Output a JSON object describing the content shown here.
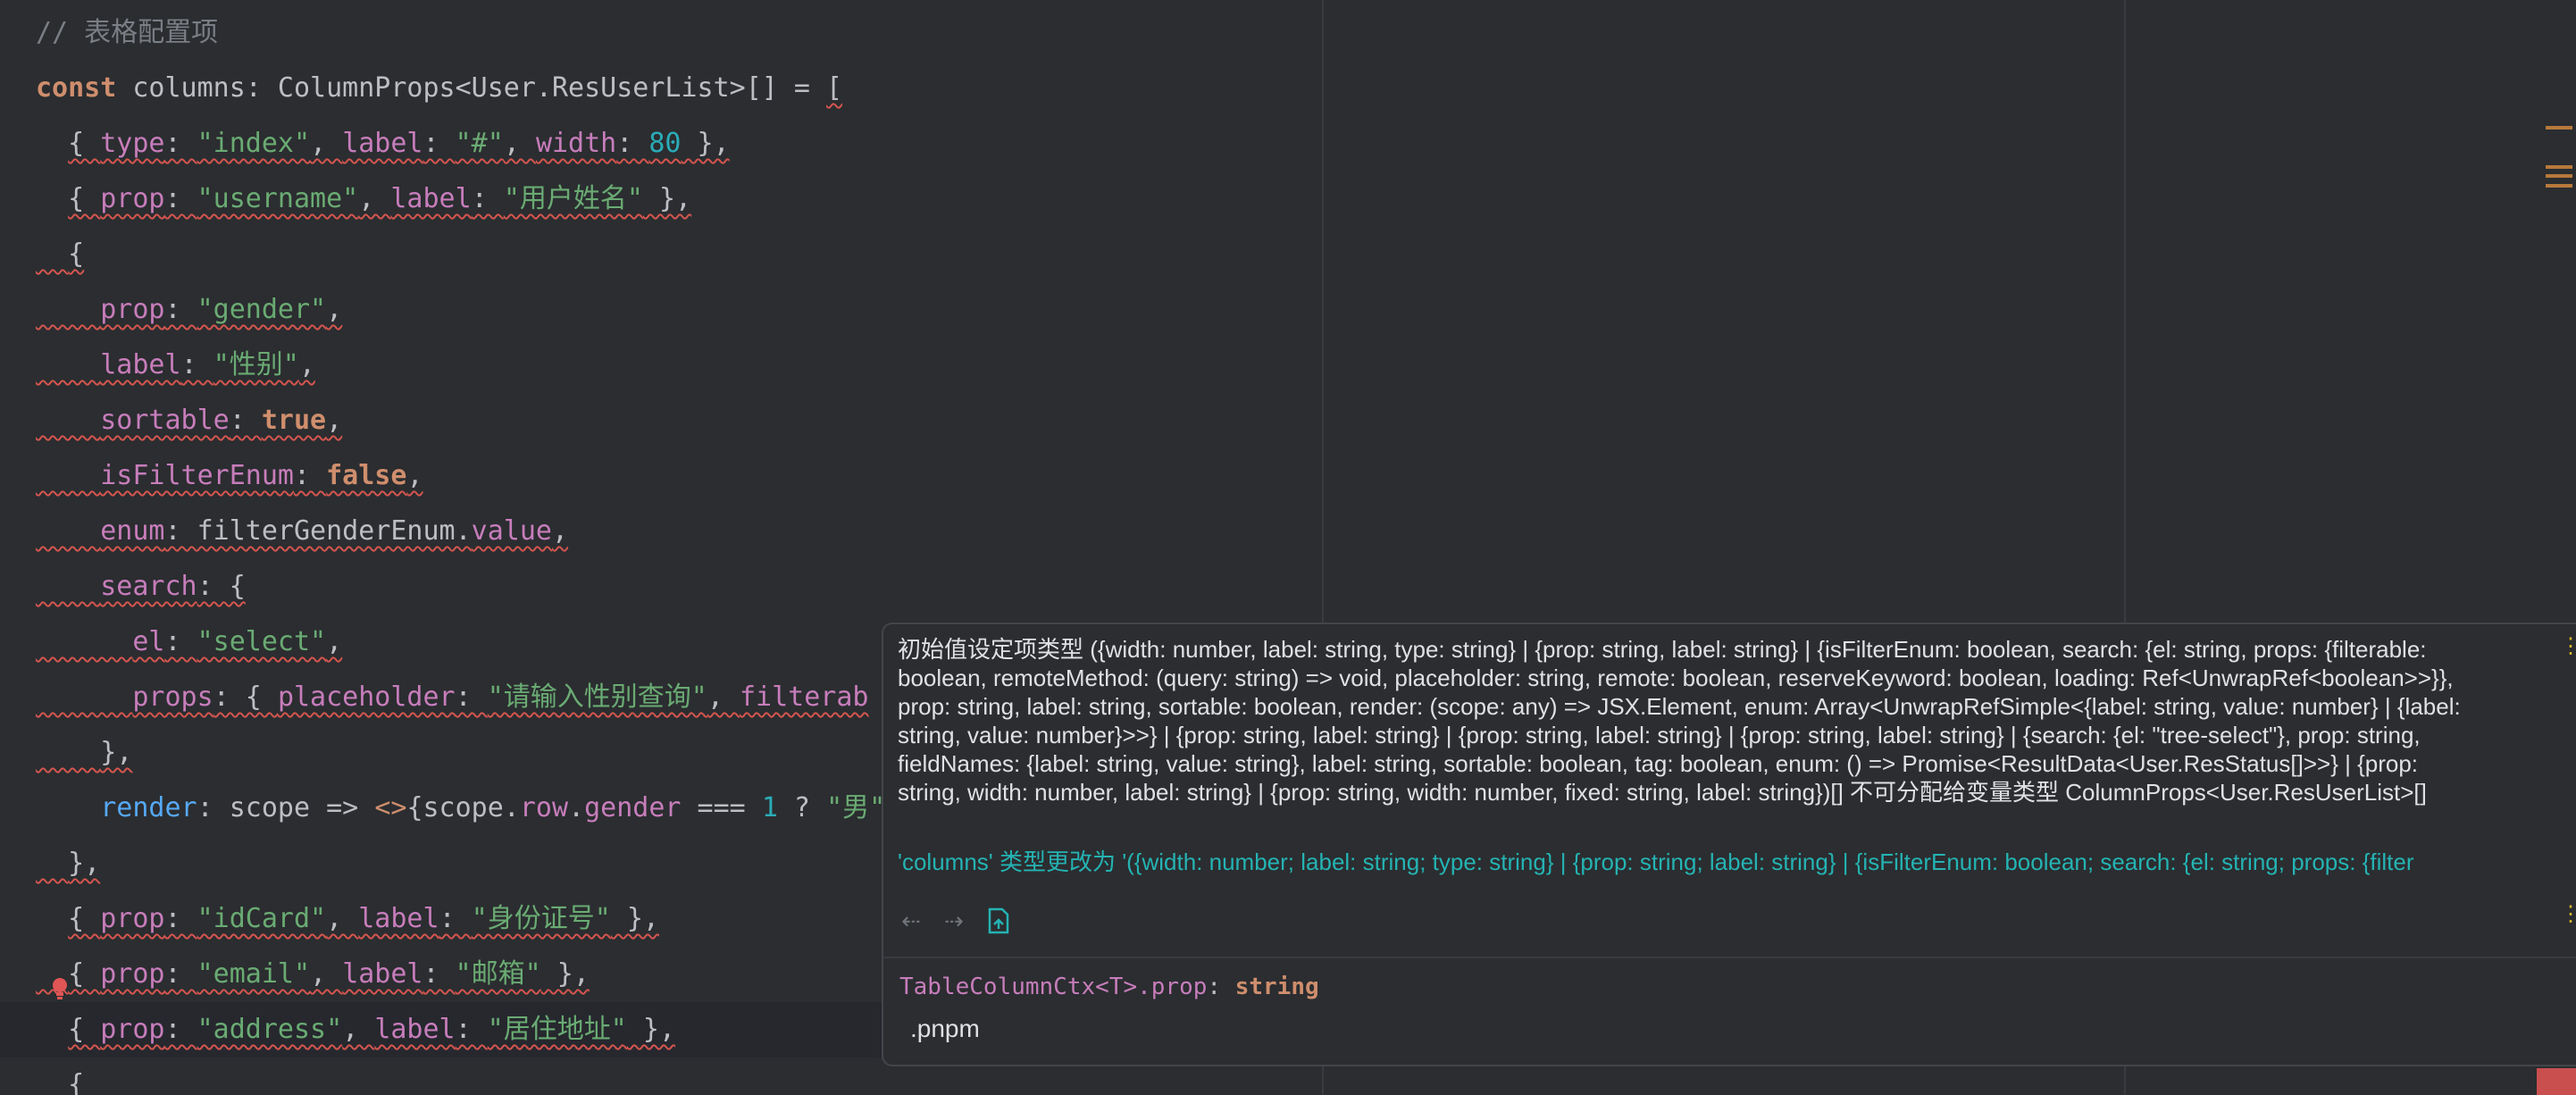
{
  "editor": {
    "lines": [
      {
        "tokens": [
          {
            "t": "// 表格配置项",
            "c": "c-comment"
          }
        ]
      },
      {
        "tokens": [
          {
            "t": "const",
            "c": "c-kw"
          },
          {
            "t": " columns: ColumnProps<User.ResUserList>[] = ",
            "c": "c-ident"
          },
          {
            "t": "[",
            "c": "c-punc",
            "e": 1
          }
        ]
      },
      {
        "tokens": [
          {
            "t": "  ",
            "c": "c-ident"
          },
          {
            "t": "{ ",
            "c": "c-punc",
            "e": 1
          },
          {
            "t": "type",
            "c": "c-prop",
            "e": 1
          },
          {
            "t": ": ",
            "c": "c-punc",
            "e": 1
          },
          {
            "t": "\"index\"",
            "c": "c-str",
            "e": 1
          },
          {
            "t": ", ",
            "c": "c-punc",
            "e": 1
          },
          {
            "t": "label",
            "c": "c-prop",
            "e": 1
          },
          {
            "t": ": ",
            "c": "c-punc",
            "e": 1
          },
          {
            "t": "\"#\"",
            "c": "c-str",
            "e": 1
          },
          {
            "t": ", ",
            "c": "c-punc",
            "e": 1
          },
          {
            "t": "width",
            "c": "c-prop",
            "e": 1
          },
          {
            "t": ": ",
            "c": "c-punc",
            "e": 1
          },
          {
            "t": "80",
            "c": "c-num",
            "e": 1
          },
          {
            "t": " },",
            "c": "c-punc",
            "e": 1
          }
        ]
      },
      {
        "tokens": [
          {
            "t": "  ",
            "c": "c-ident"
          },
          {
            "t": "{ ",
            "c": "c-punc",
            "e": 1
          },
          {
            "t": "prop",
            "c": "c-prop",
            "e": 1
          },
          {
            "t": ": ",
            "c": "c-punc",
            "e": 1
          },
          {
            "t": "\"username\"",
            "c": "c-str",
            "e": 1
          },
          {
            "t": ", ",
            "c": "c-punc",
            "e": 1
          },
          {
            "t": "label",
            "c": "c-prop",
            "e": 1
          },
          {
            "t": ": ",
            "c": "c-punc",
            "e": 1
          },
          {
            "t": "\"用户姓名\"",
            "c": "c-str",
            "e": 1
          },
          {
            "t": " },",
            "c": "c-punc",
            "e": 1
          }
        ]
      },
      {
        "tokens": [
          {
            "t": "  ",
            "c": "c-ident",
            "e": 1
          },
          {
            "t": "{",
            "c": "c-punc",
            "e": 1
          }
        ]
      },
      {
        "tokens": [
          {
            "t": "    ",
            "c": "c-ident",
            "e": 1
          },
          {
            "t": "prop",
            "c": "c-prop",
            "e": 1
          },
          {
            "t": ": ",
            "c": "c-punc",
            "e": 1
          },
          {
            "t": "\"gender\"",
            "c": "c-str",
            "e": 1
          },
          {
            "t": ",",
            "c": "c-punc",
            "e": 1
          }
        ]
      },
      {
        "tokens": [
          {
            "t": "    ",
            "c": "c-ident",
            "e": 1
          },
          {
            "t": "label",
            "c": "c-prop",
            "e": 1
          },
          {
            "t": ": ",
            "c": "c-punc",
            "e": 1
          },
          {
            "t": "\"性别\"",
            "c": "c-str",
            "e": 1
          },
          {
            "t": ",",
            "c": "c-punc",
            "e": 1
          }
        ]
      },
      {
        "tokens": [
          {
            "t": "    ",
            "c": "c-ident",
            "e": 1
          },
          {
            "t": "sortable",
            "c": "c-prop",
            "e": 1
          },
          {
            "t": ": ",
            "c": "c-punc",
            "e": 1
          },
          {
            "t": "true",
            "c": "c-kw",
            "e": 1
          },
          {
            "t": ",",
            "c": "c-punc",
            "e": 1
          }
        ]
      },
      {
        "tokens": [
          {
            "t": "    ",
            "c": "c-ident",
            "e": 1
          },
          {
            "t": "isFilterEnum",
            "c": "c-prop",
            "e": 1
          },
          {
            "t": ": ",
            "c": "c-punc",
            "e": 1
          },
          {
            "t": "false",
            "c": "c-kw",
            "e": 1
          },
          {
            "t": ",",
            "c": "c-punc",
            "e": 1
          }
        ]
      },
      {
        "tokens": [
          {
            "t": "    ",
            "c": "c-ident",
            "e": 1
          },
          {
            "t": "enum",
            "c": "c-prop",
            "e": 1
          },
          {
            "t": ": filterGenderEnum.",
            "c": "c-ident",
            "e": 1
          },
          {
            "t": "value",
            "c": "c-prop",
            "e": 1
          },
          {
            "t": ",",
            "c": "c-punc",
            "e": 1
          }
        ]
      },
      {
        "tokens": [
          {
            "t": "    ",
            "c": "c-ident",
            "e": 1
          },
          {
            "t": "search",
            "c": "c-prop",
            "e": 1
          },
          {
            "t": ": {",
            "c": "c-punc",
            "e": 1
          }
        ]
      },
      {
        "tokens": [
          {
            "t": "      ",
            "c": "c-ident",
            "e": 1
          },
          {
            "t": "el",
            "c": "c-prop",
            "e": 1
          },
          {
            "t": ": ",
            "c": "c-punc",
            "e": 1
          },
          {
            "t": "\"select\"",
            "c": "c-str",
            "e": 1
          },
          {
            "t": ",",
            "c": "c-punc",
            "e": 1
          }
        ]
      },
      {
        "tokens": [
          {
            "t": "      ",
            "c": "c-ident",
            "e": 1
          },
          {
            "t": "props",
            "c": "c-prop",
            "e": 1
          },
          {
            "t": ": { ",
            "c": "c-punc",
            "e": 1
          },
          {
            "t": "placeholder",
            "c": "c-prop",
            "e": 1
          },
          {
            "t": ": ",
            "c": "c-punc",
            "e": 1
          },
          {
            "t": "\"请输入性别查询\"",
            "c": "c-str",
            "e": 1
          },
          {
            "t": ", ",
            "c": "c-punc",
            "e": 1
          },
          {
            "t": "filterab",
            "c": "c-prop",
            "e": 1
          }
        ]
      },
      {
        "tokens": [
          {
            "t": "    ",
            "c": "c-ident",
            "e": 1
          },
          {
            "t": "},",
            "c": "c-punc",
            "e": 1
          }
        ]
      },
      {
        "tokens": [
          {
            "t": "    ",
            "c": "c-ident"
          },
          {
            "t": "render",
            "c": "c-fn"
          },
          {
            "t": ": scope => ",
            "c": "c-ident"
          },
          {
            "t": "<>",
            "c": "c-keyv"
          },
          {
            "t": "{scope.",
            "c": "c-ident"
          },
          {
            "t": "row",
            "c": "c-prop"
          },
          {
            "t": ".",
            "c": "c-ident"
          },
          {
            "t": "gender",
            "c": "c-prop"
          },
          {
            "t": " === ",
            "c": "c-ident"
          },
          {
            "t": "1",
            "c": "c-num"
          },
          {
            "t": " ? ",
            "c": "c-ident"
          },
          {
            "t": "\"男\"",
            "c": "c-str"
          }
        ]
      },
      {
        "tokens": [
          {
            "t": "  ",
            "c": "c-ident",
            "e": 1
          },
          {
            "t": "},",
            "c": "c-punc",
            "e": 1
          }
        ]
      },
      {
        "tokens": [
          {
            "t": "  ",
            "c": "c-ident"
          },
          {
            "t": "{ ",
            "c": "c-punc",
            "e": 1
          },
          {
            "t": "prop",
            "c": "c-prop",
            "e": 1
          },
          {
            "t": ": ",
            "c": "c-punc",
            "e": 1
          },
          {
            "t": "\"idCard\"",
            "c": "c-str",
            "e": 1
          },
          {
            "t": ", ",
            "c": "c-punc",
            "e": 1
          },
          {
            "t": "label",
            "c": "c-prop",
            "e": 1
          },
          {
            "t": ": ",
            "c": "c-punc",
            "e": 1
          },
          {
            "t": "\"身份证号\"",
            "c": "c-str",
            "e": 1
          },
          {
            "t": " },",
            "c": "c-punc",
            "e": 1
          }
        ]
      },
      {
        "tokens": [
          {
            "t": "  ",
            "c": "c-ident",
            "e": 1
          },
          {
            "t": "{ ",
            "c": "c-punc",
            "e": 1
          },
          {
            "t": "prop",
            "c": "c-prop",
            "e": 1
          },
          {
            "t": ": ",
            "c": "c-punc",
            "e": 1
          },
          {
            "t": "\"email\"",
            "c": "c-str",
            "e": 1
          },
          {
            "t": ", ",
            "c": "c-punc",
            "e": 1
          },
          {
            "t": "label",
            "c": "c-prop",
            "e": 1
          },
          {
            "t": ": ",
            "c": "c-punc",
            "e": 1
          },
          {
            "t": "\"邮箱\"",
            "c": "c-str",
            "e": 1
          },
          {
            "t": " },",
            "c": "c-punc",
            "e": 1
          }
        ]
      },
      {
        "tokens": [
          {
            "t": "  ",
            "c": "c-ident"
          },
          {
            "t": "{ ",
            "c": "c-punc",
            "e": 1
          },
          {
            "t": "prop",
            "c": "c-prop",
            "e": 1
          },
          {
            "t": ": ",
            "c": "c-punc",
            "e": 1
          },
          {
            "t": "\"address\"",
            "c": "c-str",
            "e": 1
          },
          {
            "t": ", ",
            "c": "c-punc",
            "e": 1
          },
          {
            "t": "label",
            "c": "c-prop",
            "e": 1
          },
          {
            "t": ": ",
            "c": "c-punc",
            "e": 1
          },
          {
            "t": "\"居住地址\"",
            "c": "c-str",
            "e": 1
          },
          {
            "t": " },",
            "c": "c-punc",
            "e": 1
          }
        ]
      },
      {
        "tokens": [
          {
            "t": "  ",
            "c": "c-ident"
          },
          {
            "t": "{",
            "c": "c-punc",
            "e": 1
          }
        ]
      }
    ]
  },
  "popup": {
    "error_text": "初始值设定项类型 ({width: number, label: string, type: string} | {prop: string, label: string} | {isFilterEnum: boolean, search: {el: string, props: {filterable: boolean, remoteMethod: (query: string) => void, placeholder: string, remote: boolean, reserveKeyword: boolean, loading: Ref<UnwrapRef<boolean>>}}, prop: string, label: string, sortable: boolean, render: (scope: any) => JSX.Element, enum: Array<UnwrapRefSimple<{label: string, value: number} | {label: string, value: number}>>} | {prop: string, label: string} | {prop: string, label: string} | {prop: string, label: string} | {search: {el: \"tree-select\"}, prop: string, fieldNames: {label: string, value: string}, label: string, sortable: boolean, tag: boolean, enum: () => Promise<ResultData<User.ResStatus[]>>} | {prop: string, width: number, label: string} | {prop: string, width: number, fixed: string, label: string})[] 不可分配给变量类型 ColumnProps<User.ResUserList>[]",
    "quick_fix": "'columns' 类型更改为 '({width: number; label: string; type: string} | {prop: string; label: string} | {isFilterEnum: boolean; search: {el: string; props: {filter",
    "signature": {
      "owner": "TableColumnCtx<T>.",
      "member": "prop",
      "sep": ": ",
      "type": "string"
    },
    "module": ".pnpm",
    "icons": {
      "back": "arrow-left-icon",
      "forward": "arrow-right-icon",
      "source": "open-source-icon",
      "more": "more-vertical-icon"
    }
  },
  "colors": {
    "background": "#2b2d30",
    "string": "#6aab73",
    "keyword": "#cf8e6d",
    "property": "#c77dbb",
    "number": "#2aacb8",
    "error_underline": "#d4554f",
    "quick_fix": "#25b3b3"
  }
}
